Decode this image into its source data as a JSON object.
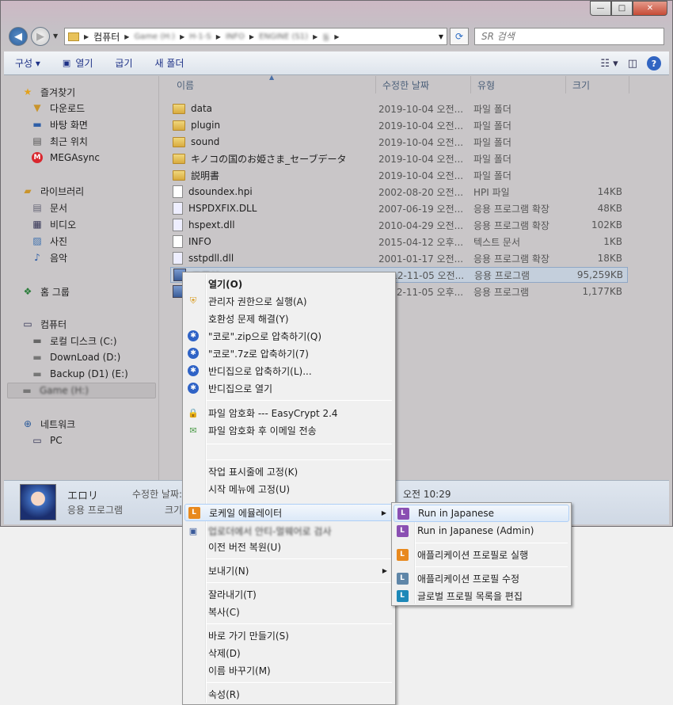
{
  "window": {
    "minimize": "—",
    "maximize": "□",
    "close": "✕"
  },
  "address": {
    "crumbs": [
      "컴퓨터",
      "Game (H:)",
      "H-1-S",
      "INFO",
      "ENGINE (S1)",
      "동"
    ],
    "search_placeholder": "SR 검색"
  },
  "toolbar": {
    "organize": "구성 ▾",
    "open": "열기",
    "burn": "굽기",
    "new_folder": "새 폴더"
  },
  "nav": {
    "favorites": "즐겨찾기",
    "downloads": "다운로드",
    "desktop": "바탕 화면",
    "recent": "최근 위치",
    "mega": "MEGAsync",
    "libraries": "라이브러리",
    "docs": "문서",
    "video": "비디오",
    "pictures": "사진",
    "music": "음악",
    "homegroup": "홈 그룹",
    "computer": "컴퓨터",
    "local_c": "로컬 디스크 (C:)",
    "download_d": "DownLoad (D:)",
    "backup_e": "Backup (D1) (E:)",
    "game_h": "Game (H:)",
    "network": "네트워크",
    "pc": "PC"
  },
  "columns": {
    "name": "이름",
    "date": "수정한 날짜",
    "type": "유형",
    "size": "크기"
  },
  "files": [
    {
      "name": "data",
      "date": "2019-10-04 오전...",
      "type": "파일 폴더",
      "size": "",
      "kind": "folder"
    },
    {
      "name": "plugin",
      "date": "2019-10-04 오전...",
      "type": "파일 폴더",
      "size": "",
      "kind": "folder"
    },
    {
      "name": "sound",
      "date": "2019-10-04 오전...",
      "type": "파일 폴더",
      "size": "",
      "kind": "folder"
    },
    {
      "name": "キノコの国のお姫さま_セーブデータ",
      "date": "2019-10-04 오전...",
      "type": "파일 폴더",
      "size": "",
      "kind": "folder"
    },
    {
      "name": "説明書",
      "date": "2019-10-04 오전...",
      "type": "파일 폴더",
      "size": "",
      "kind": "folder"
    },
    {
      "name": "dsoundex.hpi",
      "date": "2002-08-20 오전...",
      "type": "HPI 파일",
      "size": "14KB",
      "kind": "file"
    },
    {
      "name": "HSPDXFIX.DLL",
      "date": "2007-06-19 오전...",
      "type": "응용 프로그램 확장",
      "size": "48KB",
      "kind": "dll"
    },
    {
      "name": "hspext.dll",
      "date": "2010-04-29 오전...",
      "type": "응용 프로그램 확장",
      "size": "102KB",
      "kind": "dll"
    },
    {
      "name": "INFO",
      "date": "2015-04-12 오후...",
      "type": "텍스트 문서",
      "size": "1KB",
      "kind": "file"
    },
    {
      "name": "sstpdll.dll",
      "date": "2001-01-17 오전...",
      "type": "응용 프로그램 확장",
      "size": "18KB",
      "kind": "dll"
    },
    {
      "name": "エロリ",
      "date": "2012-11-05 오전...",
      "type": "응용 프로그램",
      "size": "95,259KB",
      "kind": "app"
    },
    {
      "name": "",
      "date": "2012-11-05 오후...",
      "type": "응용 프로그램",
      "size": "1,177KB",
      "kind": "app"
    }
  ],
  "details": {
    "name": "エロリ",
    "type": "응용 프로그램",
    "modified_label": "수정한 날짜:",
    "size_label": "크기:",
    "modified_value": "오전 10:29"
  },
  "context_menu": {
    "open": "열기(O)",
    "run_admin": "관리자 권한으로 실행(A)",
    "troubleshoot": "호환성 문제 해결(Y)",
    "zip": "\"코로\".zip으로 압축하기(Q)",
    "sevenz": "\"코로\".7z로 압축하기(7)",
    "bandizip_compress": "반디집으로 압축하기(L)...",
    "bandizip_open": "반디집으로 열기",
    "encrypt": "파일 암호화 --- EasyCrypt 2.4",
    "encrypt_email": "파일 암호화 후 이메일 전송",
    "pin_taskbar": "작업 표시줄에 고정(K)",
    "pin_start": "시작 메뉴에 고정(U)",
    "locale_emulator": "로케일 에뮬레이터",
    "blurred_item": "업로더에서 안티-멀웨어로 검사",
    "restore": "이전 버전 복원(U)",
    "send_to": "보내기(N)",
    "cut": "잘라내기(T)",
    "copy": "복사(C)",
    "shortcut": "바로 가기 만들기(S)",
    "delete": "삭제(D)",
    "rename": "이름 바꾸기(M)",
    "properties": "속성(R)"
  },
  "submenu": {
    "run_jp": "Run in Japanese",
    "run_jp_admin": "Run in Japanese (Admin)",
    "run_profile": "애플리케이션 프로필로 실행",
    "edit_profile": "애플리케이션 프로필 수정",
    "edit_global": "글로벌 프로필 목록을 편집"
  }
}
